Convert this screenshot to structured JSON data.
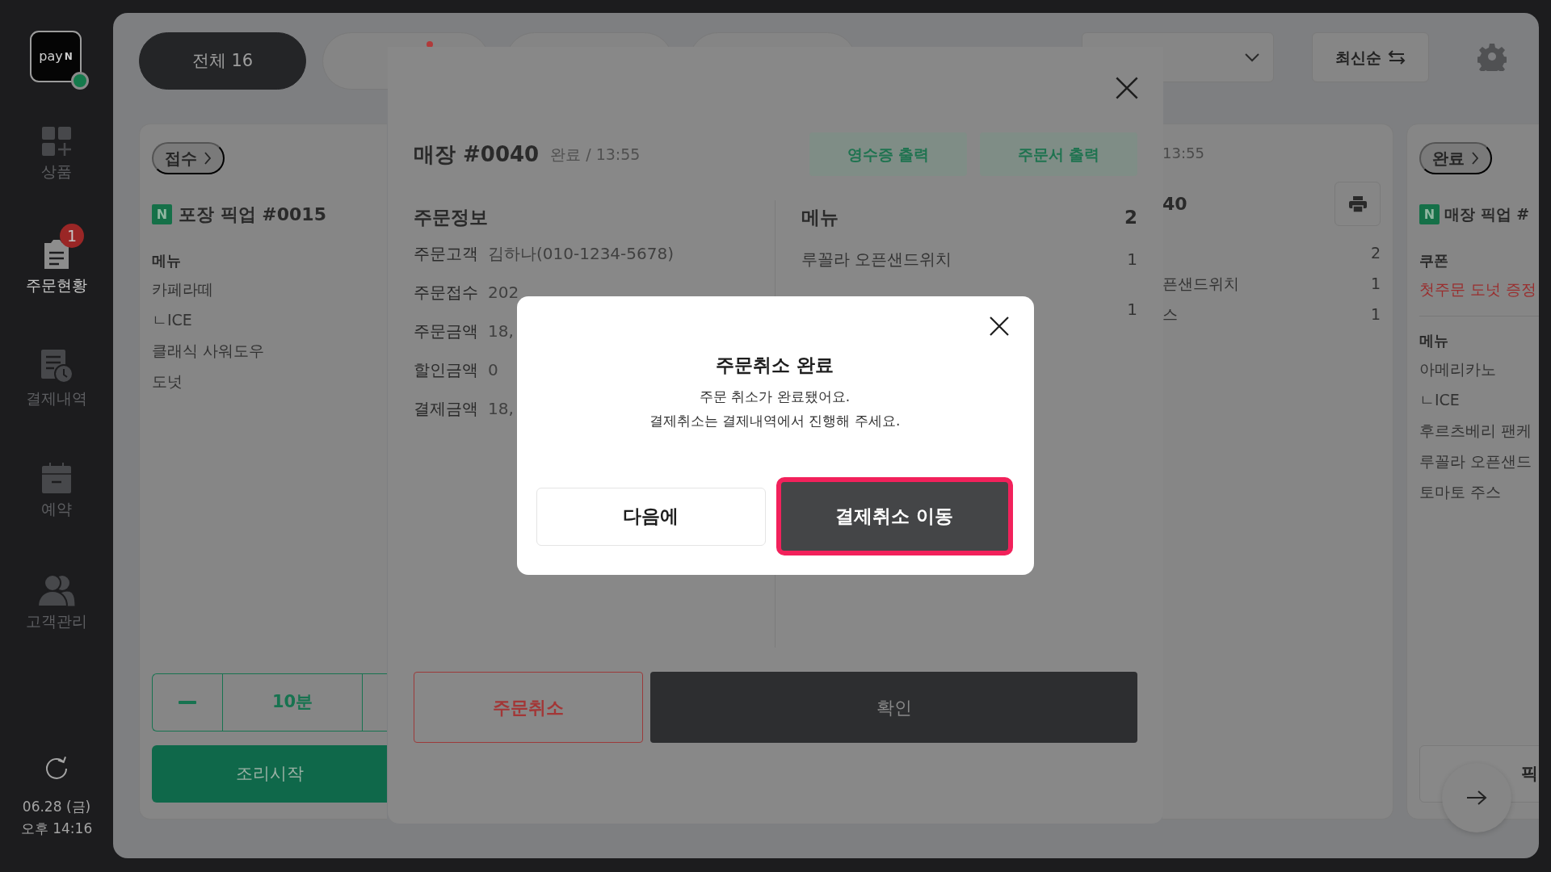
{
  "sidebar": {
    "logo": {
      "text": "pay",
      "mark": "N",
      "online": true
    },
    "items": [
      {
        "label": "상품",
        "kind": "products",
        "selected": false
      },
      {
        "label": "주문현황",
        "kind": "orders",
        "selected": true,
        "badge": "1"
      },
      {
        "label": "결제내역",
        "kind": "payments",
        "selected": false
      },
      {
        "label": "예약",
        "kind": "reservations",
        "selected": false
      },
      {
        "label": "고객관리",
        "kind": "customers",
        "selected": false
      }
    ],
    "date": "06.28 (금)",
    "time": "오후 14:16"
  },
  "tabs": [
    {
      "label": "전체 16",
      "selected": true,
      "unread": false
    },
    {
      "selected": false,
      "unread": true
    },
    {
      "selected": false,
      "unread": false
    },
    {
      "selected": false,
      "unread": false
    }
  ],
  "sort_button": {
    "label": "최신순"
  },
  "order_cards": [
    {
      "chip": {
        "label": "접수"
      },
      "badge": "N",
      "title": "포장 픽업 #0015",
      "sections": [
        {
          "kind": "menu",
          "heading": "메뉴",
          "items": [
            {
              "name": "카페라떼"
            },
            {
              "name": "ㄴICE"
            },
            {
              "name": "클래식 사워도우"
            },
            {
              "name": "도넛"
            }
          ]
        }
      ],
      "stepper": {
        "value": "10분"
      },
      "action": {
        "label": "조리시작",
        "kind": "start"
      }
    },
    {
      "time": "13:55",
      "title": "40",
      "print": true,
      "sections": [
        {
          "kind": "menu",
          "items": [
            {
              "qty": "2"
            },
            {
              "name": "픈샌드위치",
              "qty": "1"
            },
            {
              "name": "스",
              "qty": "1"
            }
          ]
        }
      ]
    },
    {
      "chip": {
        "label": "완료"
      },
      "badge": "N",
      "title": "매장 픽업 #",
      "sections": [
        {
          "kind": "coupon",
          "heading": "쿠폰",
          "items": [
            {
              "name": "첫주문 도넛 증정"
            }
          ]
        },
        {
          "kind": "menu",
          "heading": "메뉴",
          "items": [
            {
              "name": "아메리카노"
            },
            {
              "name": "ㄴICE"
            },
            {
              "name": "후르츠베리 팬케"
            },
            {
              "name": "루꼴라 오픈샌드"
            },
            {
              "name": "토마토 주스"
            }
          ]
        }
      ],
      "action": {
        "label": "픽",
        "kind": "pickup"
      }
    }
  ],
  "detail_panel": {
    "title": "매장 #0040",
    "status": "완료 / 13:55",
    "buttons": [
      "영수증 출력",
      "주문서 출력"
    ],
    "info": {
      "heading": "주문정보",
      "rows": [
        {
          "label": "주문고객",
          "value": "김하나(010-1234-5678)"
        },
        {
          "label": "주문접수",
          "value": "202"
        },
        {
          "label": "주문금액",
          "value": "18,"
        },
        {
          "label": "할인금액",
          "value": "0"
        },
        {
          "label": "결제금액",
          "value": "18,"
        }
      ]
    },
    "menu": {
      "heading": "메뉴",
      "count": "2",
      "items": [
        {
          "name": "루꼴라 오픈샌드위치",
          "qty": "1"
        },
        {
          "qty": "1"
        }
      ]
    },
    "cancel_button": "주문취소",
    "confirm_button": "확인"
  },
  "modal": {
    "title": "주문취소 완료",
    "message": [
      "주문 취소가 완료됐어요.",
      "결제취소는 결제내역에서 진행해 주세요."
    ],
    "buttons": [
      {
        "label": "다음에",
        "kind": "secondary",
        "highlighted": false
      },
      {
        "label": "결제취소 이동",
        "kind": "primary",
        "highlighted": true
      }
    ]
  }
}
